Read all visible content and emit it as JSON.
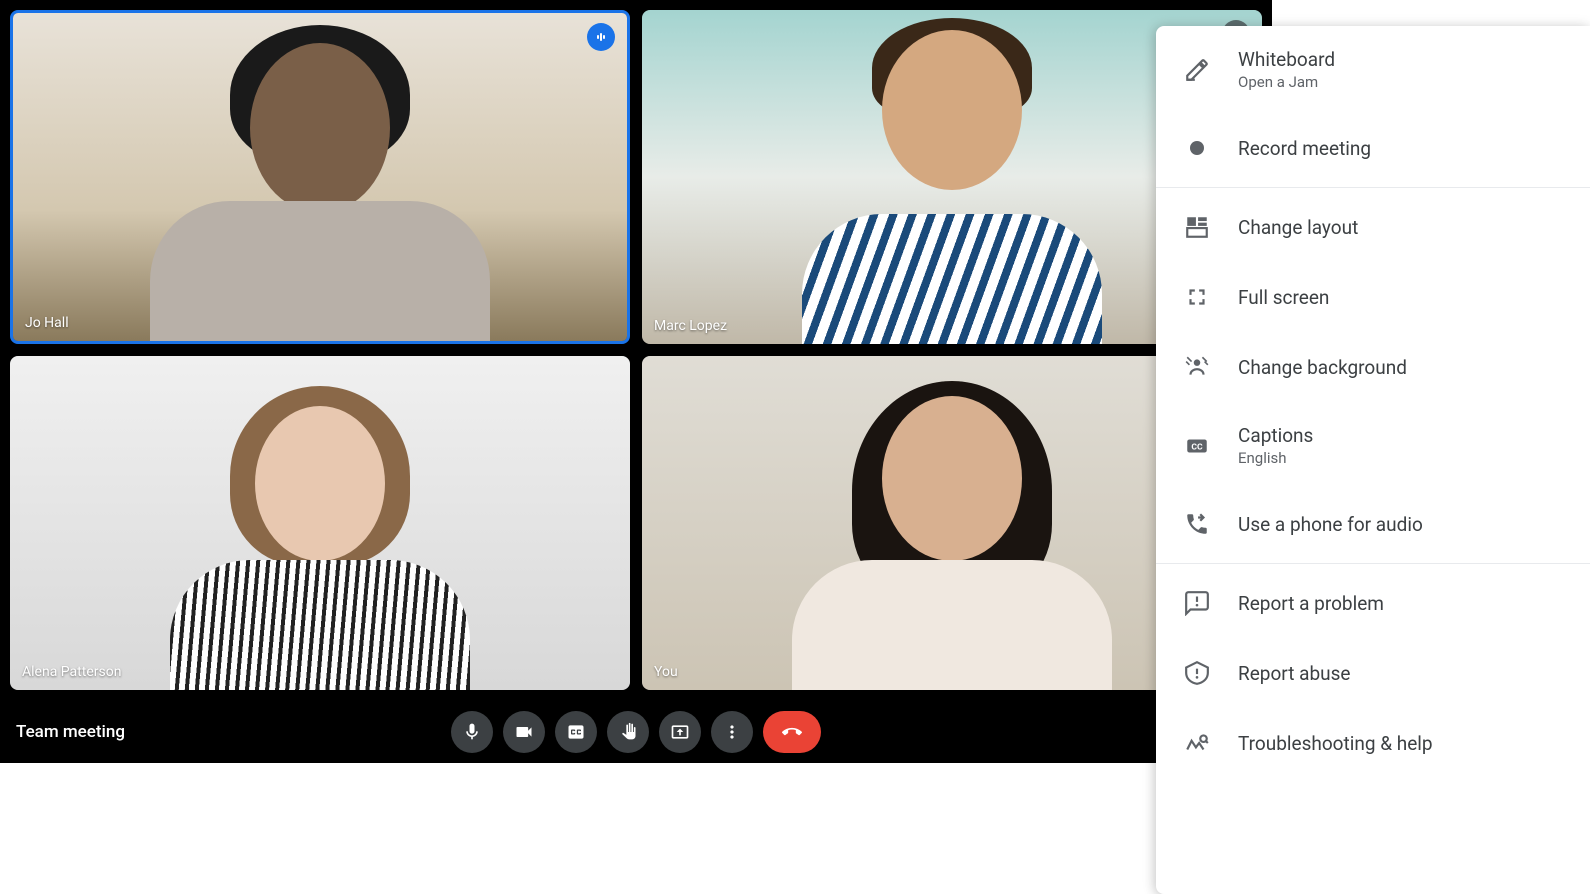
{
  "meeting": {
    "name": "Team meeting"
  },
  "participants": [
    {
      "name": "Jo Hall",
      "speaking": true,
      "muted": false,
      "active": true
    },
    {
      "name": "Marc Lopez",
      "speaking": false,
      "muted": true,
      "active": false
    },
    {
      "name": "Alena Patterson",
      "speaking": false,
      "muted": false,
      "active": false
    },
    {
      "name": "You",
      "speaking": false,
      "muted": false,
      "active": false
    }
  ],
  "controls": {
    "mic": "Microphone",
    "camera": "Camera",
    "captions": "Captions",
    "raise_hand": "Raise hand",
    "present": "Present",
    "more": "More options",
    "end_call": "Leave call"
  },
  "menu": {
    "whiteboard": {
      "label": "Whiteboard",
      "sublabel": "Open a Jam"
    },
    "record": {
      "label": "Record meeting"
    },
    "layout": {
      "label": "Change layout"
    },
    "fullscreen": {
      "label": "Full screen"
    },
    "background": {
      "label": "Change background"
    },
    "captions": {
      "label": "Captions",
      "sublabel": "English"
    },
    "phone": {
      "label": "Use a phone for audio"
    },
    "report_problem": {
      "label": "Report a problem"
    },
    "report_abuse": {
      "label": "Report abuse"
    },
    "troubleshoot": {
      "label": "Troubleshooting & help"
    }
  }
}
